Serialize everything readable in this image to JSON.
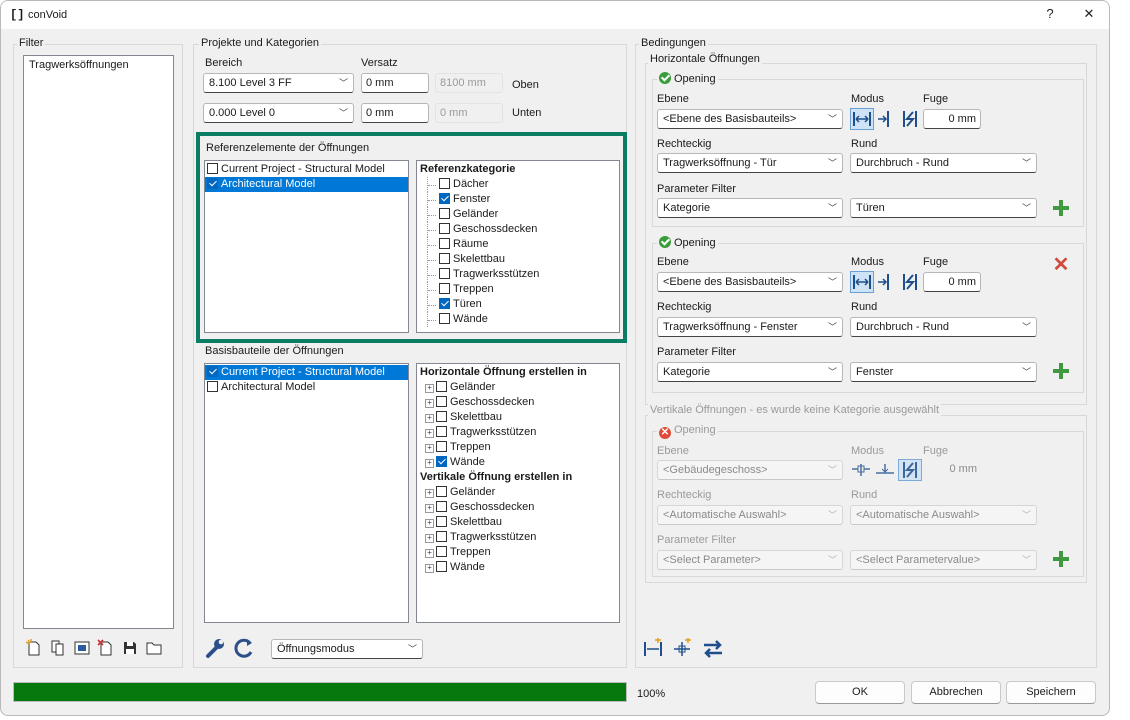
{
  "window": {
    "title": "conVoid",
    "help_label": "?",
    "close_label": "✕",
    "app_icon": "bracket-logo-icon"
  },
  "filter": {
    "title": "Filter",
    "items": [
      {
        "label": "Tragwerksöffnungen"
      }
    ],
    "toolbar_icons": [
      "new-filter-icon",
      "copy-filter-icon",
      "rename-filter-icon",
      "delete-filter-icon",
      "save-icon",
      "open-folder-icon"
    ]
  },
  "projects": {
    "title": "Projekte und Kategorien",
    "range_label": "Bereich",
    "offset_label": "Versatz",
    "top": {
      "level": "8.100  Level 3 FF",
      "offset": "0 mm",
      "elevation": "8100 mm",
      "label": "Oben"
    },
    "bottom": {
      "level": "0.000  Level 0",
      "offset": "0 mm",
      "elevation": "0 mm",
      "label": "Unten"
    }
  },
  "references": {
    "title": "Referenzelemente der Öffnungen",
    "models": [
      {
        "label": "Current Project - Structural Model",
        "checked": false,
        "selected": false
      },
      {
        "label": "Architectural Model",
        "checked": true,
        "selected": true
      }
    ],
    "category_header": "Referenzkategorie",
    "categories": [
      {
        "label": "Dächer",
        "checked": false
      },
      {
        "label": "Fenster",
        "checked": true
      },
      {
        "label": "Geländer",
        "checked": false
      },
      {
        "label": "Geschossdecken",
        "checked": false
      },
      {
        "label": "Räume",
        "checked": false
      },
      {
        "label": "Skelettbau",
        "checked": false
      },
      {
        "label": "Tragwerksstützen",
        "checked": false
      },
      {
        "label": "Treppen",
        "checked": false
      },
      {
        "label": "Türen",
        "checked": true
      },
      {
        "label": "Wände",
        "checked": false
      }
    ]
  },
  "base": {
    "title": "Basisbauteile der Öffnungen",
    "models": [
      {
        "label": "Current Project - Structural Model",
        "checked": true,
        "selected": true
      },
      {
        "label": "Architectural Model",
        "checked": false,
        "selected": false
      }
    ],
    "horizontal_header": "Horizontale Öffnung erstellen in",
    "horizontal": [
      {
        "label": "Geländer",
        "checked": false
      },
      {
        "label": "Geschossdecken",
        "checked": false
      },
      {
        "label": "Skelettbau",
        "checked": false
      },
      {
        "label": "Tragwerksstützen",
        "checked": false
      },
      {
        "label": "Treppen",
        "checked": false
      },
      {
        "label": "Wände",
        "checked": true
      }
    ],
    "vertical_header": "Vertikale Öffnung erstellen in",
    "vertical": [
      {
        "label": "Geländer",
        "checked": false
      },
      {
        "label": "Geschossdecken",
        "checked": false
      },
      {
        "label": "Skelettbau",
        "checked": false
      },
      {
        "label": "Tragwerksstützen",
        "checked": false
      },
      {
        "label": "Treppen",
        "checked": false
      },
      {
        "label": "Wände",
        "checked": false
      }
    ]
  },
  "mode_select": {
    "value": "Öffnungsmodus"
  },
  "conditions": {
    "title": "Bedingungen",
    "horizontal_title": "Horizontale Öffnungen",
    "vertical_title": "Vertikale Öffnungen - es wurde keine Kategorie ausgewählt",
    "labels": {
      "opening": "Opening",
      "ebene": "Ebene",
      "modus": "Modus",
      "fuge": "Fuge",
      "rechteckig": "Rechteckig",
      "rund": "Rund",
      "parameter": "Parameter Filter"
    },
    "h1": {
      "ebene": "<Ebene des Basisbauteils>",
      "fuge": "0 mm",
      "rechteckig": "Tragwerksöffnung - Tür",
      "rund": "Durchbruch - Rund",
      "param": "Kategorie",
      "value": "Türen"
    },
    "h2": {
      "ebene": "<Ebene des Basisbauteils>",
      "fuge": "0 mm",
      "rechteckig": "Tragwerksöffnung - Fenster",
      "rund": "Durchbruch - Rund",
      "param": "Kategorie",
      "value": "Fenster"
    },
    "v1": {
      "ebene": "<Gebäudegeschoss>",
      "fuge": "0 mm",
      "rechteckig": "<Automatische Auswahl>",
      "rund": "<Automatische Auswahl>",
      "param": "<Select Parameter>",
      "value": "<Select Parametervalue>"
    }
  },
  "footer": {
    "progress_text": "100%",
    "progress_value": 1.0,
    "ok": "OK",
    "cancel": "Abbrechen",
    "save": "Speichern"
  },
  "colors": {
    "accent": "#0078d7",
    "progress": "#06780e",
    "highlight": "#0a7d63",
    "add": "#3f9a3f",
    "remove": "#d04b3a"
  }
}
